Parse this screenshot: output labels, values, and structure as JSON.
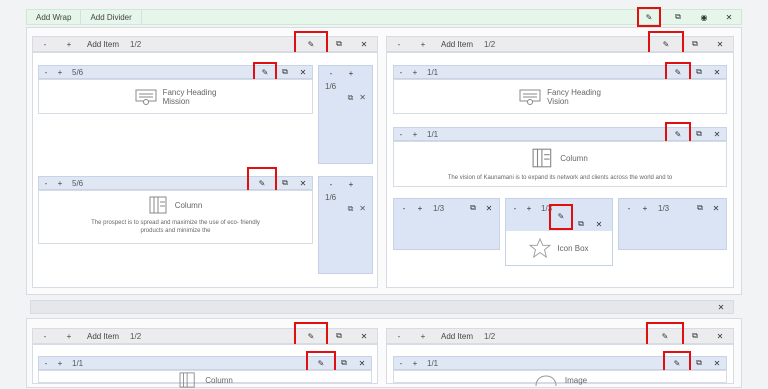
{
  "top_toolbar": {
    "add_wrap": "Add Wrap",
    "add_divider": "Add Divider"
  },
  "row1": {
    "left": {
      "add_item": "Add Item",
      "ratio": "1/2",
      "inner1": {
        "ratio": "5/6",
        "title": "Fancy Heading",
        "subtitle": "Mission",
        "side_ratio": "1/6"
      },
      "inner2": {
        "ratio": "5/6",
        "title": "Column",
        "text": "The prospect is to spread and maximize the use of eco- friendly products and minimize the",
        "side_ratio": "1/6"
      }
    },
    "right": {
      "add_item": "Add Item",
      "ratio": "1/2",
      "inner1": {
        "ratio": "1/1",
        "title": "Fancy Heading",
        "subtitle": "Vision"
      },
      "inner2": {
        "ratio": "1/1",
        "title": "Column",
        "text": "The vision of Kaunamani is to expand its network and clients across the world and to"
      },
      "inner3": {
        "c1": "1/3",
        "c2": "1/3",
        "c3": "1/3",
        "icon_title": "Icon Box"
      }
    }
  },
  "row2": {
    "left": {
      "add_item": "Add Item",
      "ratio": "1/2",
      "inner": {
        "ratio": "1/1",
        "title": "Column"
      }
    },
    "right": {
      "add_item": "Add Item",
      "ratio": "1/2",
      "inner": {
        "ratio": "1/1",
        "title": "Image"
      }
    }
  },
  "symbols": {
    "minus": "-",
    "plus": "+",
    "edit": "✎",
    "copy": "⧉",
    "eye": "◉",
    "close": "✕"
  }
}
